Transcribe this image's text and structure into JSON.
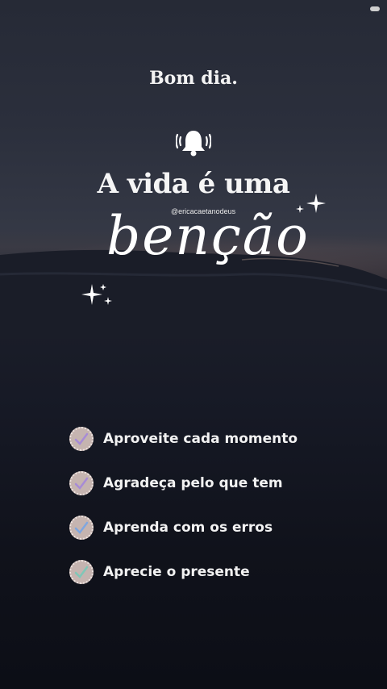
{
  "header": {
    "greeting": "Bom dia.",
    "bell_icon": "bell-icon"
  },
  "headline": {
    "line1": "A vida é uma",
    "script_word": "bençãο",
    "handle": "@ericacaetanodeus"
  },
  "list": {
    "items": [
      {
        "label": "Aproveite cada momento",
        "icon": "check-icon",
        "check_color": "#a78bd6"
      },
      {
        "label": "Agradeça pelo que tem",
        "icon": "check-icon",
        "check_color": "#a78bd6"
      },
      {
        "label": "Aprenda com os erros",
        "icon": "check-icon",
        "check_color": "#7ea6e0"
      },
      {
        "label": "Aprecie o presente",
        "icon": "check-icon",
        "check_color": "#7fc7b8"
      }
    ]
  },
  "colors": {
    "text": "#f2f2f2",
    "badge": "#c5b4b0",
    "sky_top": "#262a36",
    "sea_bottom": "#0c0e16"
  }
}
